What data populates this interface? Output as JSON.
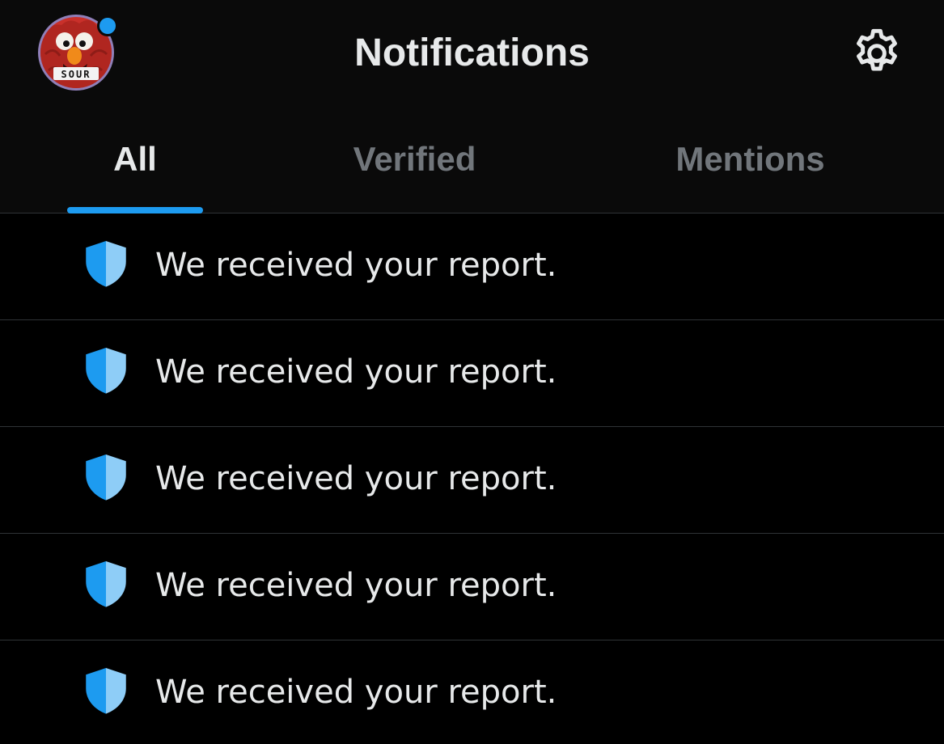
{
  "colors": {
    "background": "#000000",
    "header_background": "#0a0a0a",
    "accent": "#1d9bf0",
    "text_primary": "#e7e9ea",
    "text_secondary": "#71767b",
    "divider": "#2f3336"
  },
  "header": {
    "title": "Notifications",
    "avatar": {
      "badge_text": "SOUR",
      "has_notification_dot": true
    },
    "settings_icon": "gear-icon"
  },
  "tabs": [
    {
      "label": "All",
      "selected": true
    },
    {
      "label": "Verified",
      "selected": false
    },
    {
      "label": "Mentions",
      "selected": false
    }
  ],
  "notifications": [
    {
      "icon": "shield-icon",
      "text": "We received your report."
    },
    {
      "icon": "shield-icon",
      "text": "We received your report."
    },
    {
      "icon": "shield-icon",
      "text": "We received your report."
    },
    {
      "icon": "shield-icon",
      "text": "We received your report."
    },
    {
      "icon": "shield-icon",
      "text": "We received your report."
    }
  ]
}
